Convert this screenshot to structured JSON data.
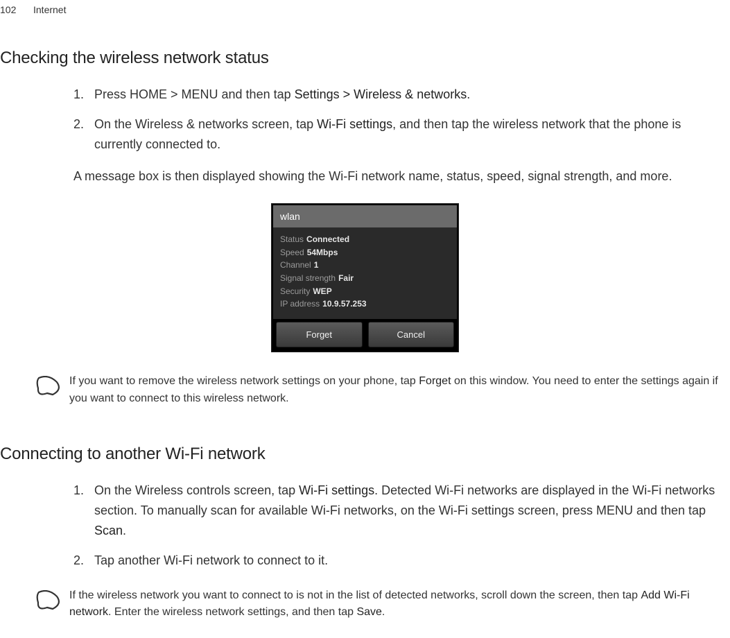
{
  "header": {
    "page_number": "102",
    "section": "Internet"
  },
  "section1": {
    "heading": "Checking the wireless network status",
    "steps": [
      {
        "num": "1.",
        "pre1": "Press HOME > MENU and then tap ",
        "bold1": "Settings > Wireless & networks",
        "post1": "."
      },
      {
        "num": "2.",
        "pre1": "On the Wireless & networks screen, tap ",
        "bold1": "Wi-Fi settings",
        "post1": ", and then tap the wireless network that the phone is currently connected to."
      }
    ],
    "after": "A message box is then displayed showing the Wi-Fi network name, status, speed, signal strength, and more."
  },
  "dialog": {
    "title": "wlan",
    "rows": [
      {
        "label": "Status",
        "value": "Connected"
      },
      {
        "label": "Speed",
        "value": "54Mbps"
      },
      {
        "label": "Channel",
        "value": "1"
      },
      {
        "label": "Signal strength",
        "value": "Fair"
      },
      {
        "label": "Security",
        "value": "WEP"
      },
      {
        "label": "IP address",
        "value": "10.9.57.253"
      }
    ],
    "btn_forget": "Forget",
    "btn_cancel": "Cancel"
  },
  "tip1": {
    "pre1": "If you want to remove the wireless network settings on your phone, tap ",
    "bold1": "Forget",
    "post1": " on this window. You need to enter the settings again if you want to connect to this wireless network."
  },
  "section2": {
    "heading": "Connecting to another Wi-Fi network",
    "steps": [
      {
        "num": "1.",
        "pre1": "On the Wireless controls screen, tap ",
        "bold1": "Wi-Fi settings",
        "mid1": ". Detected Wi-Fi networks are displayed in the Wi-Fi networks section. To manually scan for available Wi-Fi networks, on the Wi-Fi settings screen, press MENU and then tap ",
        "bold2": "Scan",
        "post1": "."
      },
      {
        "num": "2.",
        "pre1": "Tap another Wi-Fi network to connect to it.",
        "bold1": "",
        "post1": ""
      }
    ]
  },
  "tip2": {
    "pre1": "If the wireless network you want to connect to is not in the list of detected networks, scroll down the screen, then tap ",
    "bold1": "Add Wi-Fi network",
    "mid1": ". Enter the wireless network settings, and then tap ",
    "bold2": "Save",
    "post1": "."
  }
}
